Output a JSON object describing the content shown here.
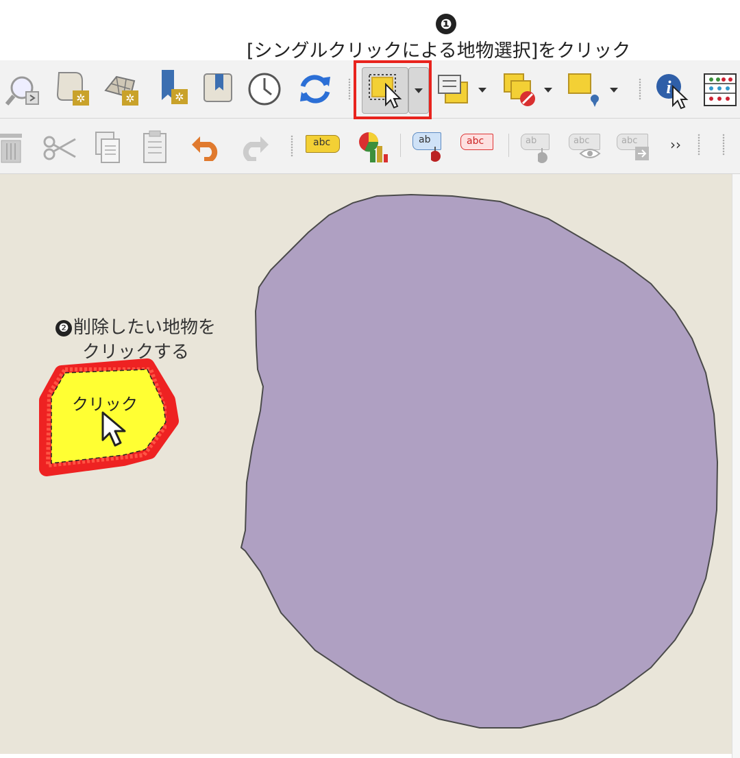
{
  "instructions": {
    "step1_number": "❶",
    "step1_text": "[シングルクリックによる地物選択]をクリック",
    "step2_number": "❷",
    "step2_line1": "削除したい地物を",
    "step2_line2": "クリックする",
    "feature_click_label": "クリック"
  },
  "toolbar_top": {
    "buttons": [
      "identify-zoom-icon",
      "new-layer-icon",
      "new-mesh-icon",
      "new-bookmark-icon",
      "show-bookmarks-icon",
      "temporal-controller-icon",
      "refresh-icon",
      "select-feature-icon",
      "select-by-value-icon",
      "deselect-icon",
      "select-by-location-icon",
      "identify-features-icon",
      "statistics-icon"
    ]
  },
  "toolbar_bottom": {
    "label_buttons": [
      "abc",
      "ab",
      "abc",
      "ab",
      "abc",
      "abc"
    ],
    "overflow": "››"
  },
  "colors": {
    "highlight_border": "#e8231d",
    "map_background": "#e9e5d9",
    "polygon_fill": "#afa0c2",
    "selected_fill": "#ffff33",
    "scribble": "#ee2222"
  }
}
